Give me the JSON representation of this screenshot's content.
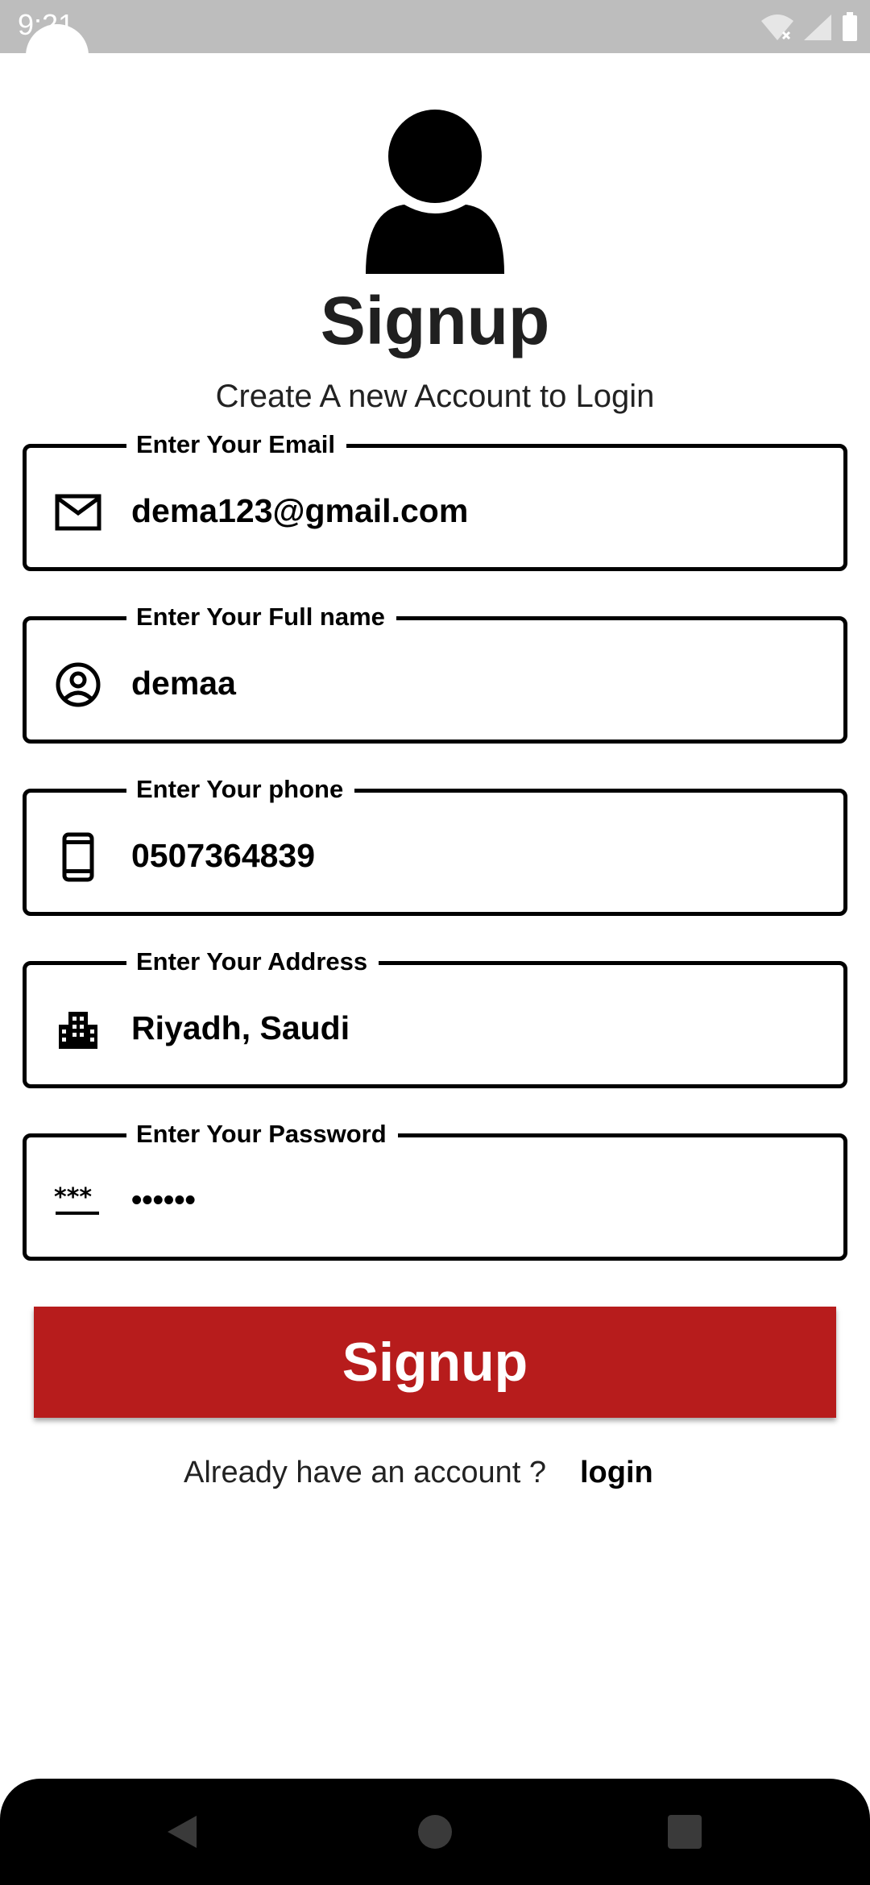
{
  "status_bar": {
    "time": "9:21",
    "icons": [
      "wifi-off-icon",
      "signal-icon",
      "battery-icon"
    ]
  },
  "header": {
    "avatar_icon": "person-icon",
    "title": "Signup",
    "subtitle": "Create A new Account to Login"
  },
  "form": {
    "email": {
      "label": "Enter Your Email",
      "value": "dema123@gmail.com",
      "icon": "mail-icon"
    },
    "fullname": {
      "label": "Enter Your Full name",
      "value": "demaa",
      "icon": "account-circle-icon"
    },
    "phone": {
      "label": "Enter Your phone",
      "value": "0507364839",
      "icon": "smartphone-icon"
    },
    "address": {
      "label": "Enter Your Address",
      "value": "Riyadh, Saudi",
      "icon": "city-icon"
    },
    "password": {
      "label": "Enter Your Password",
      "value": "••••••",
      "icon": "password-icon"
    }
  },
  "actions": {
    "signup_label": "Signup",
    "footer_text": "Already have an account ?",
    "login_label": "login",
    "signup_color": "#b71c1c"
  },
  "nav": {
    "buttons": [
      "back-icon",
      "home-icon",
      "recents-icon"
    ]
  }
}
